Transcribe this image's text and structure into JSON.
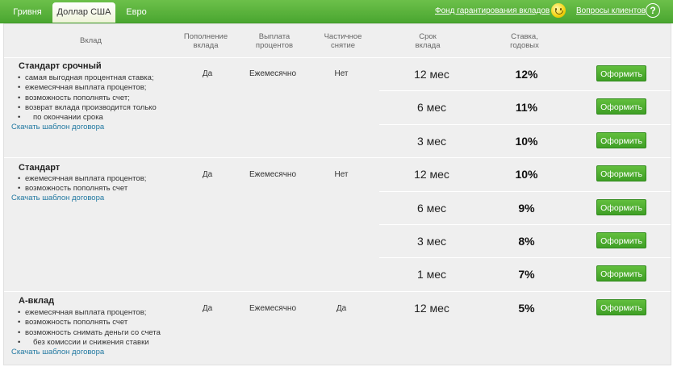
{
  "tabs": [
    {
      "label": "Гривня",
      "active": false
    },
    {
      "label": "Доллар США",
      "active": true
    },
    {
      "label": "Евро",
      "active": false
    }
  ],
  "links": {
    "guarantee_fund": "Фонд гарантирования вкладов",
    "client_questions": "Вопросы клиентов"
  },
  "headers": {
    "deposit": "Вклад",
    "replenish": [
      "Пополнение",
      "вклада"
    ],
    "payout": [
      "Выплата",
      "процентов"
    ],
    "partial": [
      "Частичное",
      "снятие"
    ],
    "term": [
      "Срок",
      "вклада"
    ],
    "rate": [
      "Ставка,",
      "годовых"
    ]
  },
  "deposits": [
    {
      "name": "Стандарт срочный",
      "features": [
        "самая выгодная процентная ставка;",
        "ежемесячная выплата процентов;",
        "возможность пополнять счет;",
        "возврат вклада производится только",
        "по окончании срока"
      ],
      "download": "Скачать шаблон договора",
      "replenish": "Да",
      "payout": "Ежемесячно",
      "partial": "Нет",
      "rows": [
        {
          "term": "12 мес",
          "rate": "12%",
          "button": "Оформить"
        },
        {
          "term": "6 мес",
          "rate": "11%",
          "button": "Оформить"
        },
        {
          "term": "3 мес",
          "rate": "10%",
          "button": "Оформить"
        }
      ]
    },
    {
      "name": "Стандарт",
      "features": [
        "ежемесячная выплата процентов;",
        "возможность пополнять счет"
      ],
      "download": "Скачать шаблон договора",
      "replenish": "Да",
      "payout": "Ежемесячно",
      "partial": "Нет",
      "rows": [
        {
          "term": "12 мес",
          "rate": "10%",
          "button": "Оформить"
        },
        {
          "term": "6 мес",
          "rate": "9%",
          "button": "Оформить"
        },
        {
          "term": "3 мес",
          "rate": "8%",
          "button": "Оформить"
        },
        {
          "term": "1 мес",
          "rate": "7%",
          "button": "Оформить"
        }
      ]
    },
    {
      "name": "А-вклад",
      "features": [
        "ежемесячная выплата процентов;",
        "возможность пополнять счет",
        "возможность снимать деньги со счета",
        "без комиссии и снижения ставки"
      ],
      "download": "Скачать шаблон договора",
      "replenish": "Да",
      "payout": "Ежемесячно",
      "partial": "Да",
      "rows": [
        {
          "term": "12 мес",
          "rate": "5%",
          "button": "Оформить"
        }
      ]
    }
  ]
}
